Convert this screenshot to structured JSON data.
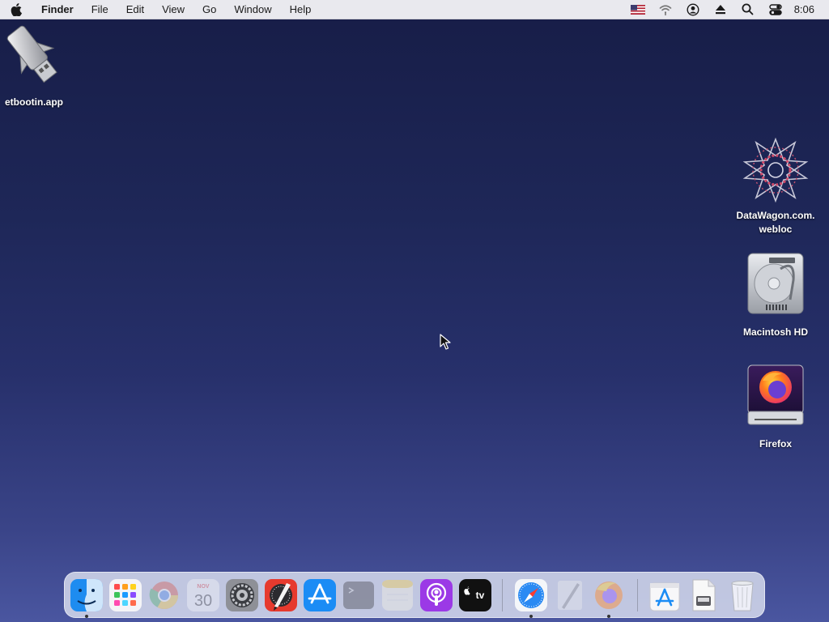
{
  "menubar": {
    "app_name": "Finder",
    "items": [
      "File",
      "Edit",
      "View",
      "Go",
      "Window",
      "Help"
    ],
    "status_icons": [
      "flag-us-icon",
      "wifi-icon",
      "user-icon",
      "eject-icon",
      "search-icon",
      "control-center-icon"
    ],
    "clock": "8:06"
  },
  "desktop": {
    "icons": [
      {
        "label": "etbootin.app",
        "icon": "usb-drive-icon"
      },
      {
        "label": "DataWagon.com.\nwebloc",
        "icon": "webloc-icon"
      },
      {
        "label": "Macintosh HD",
        "icon": "hard-drive-icon"
      },
      {
        "label": "Firefox",
        "icon": "firefox-disk-icon"
      }
    ]
  },
  "dock": {
    "apps": [
      {
        "name": "Finder",
        "icon": "finder-icon",
        "running": true
      },
      {
        "name": "Launchpad",
        "icon": "launchpad-icon",
        "running": false
      },
      {
        "name": "Chrome",
        "icon": "chrome-icon",
        "running": false
      },
      {
        "name": "Calendar",
        "icon": "calendar-icon",
        "running": false,
        "day": "30",
        "month": "NOV"
      },
      {
        "name": "System Preferences",
        "icon": "system-preferences-icon",
        "running": false
      },
      {
        "name": "Script Editor",
        "icon": "script-editor-icon",
        "running": false
      },
      {
        "name": "App Store",
        "icon": "app-store-icon",
        "running": false
      },
      {
        "name": "Terminal",
        "icon": "terminal-icon",
        "running": false
      },
      {
        "name": "Notes",
        "icon": "notes-icon",
        "running": false
      },
      {
        "name": "Podcasts",
        "icon": "podcasts-icon",
        "running": false
      },
      {
        "name": "TV",
        "icon": "apple-tv-icon",
        "running": false,
        "text": "tv"
      },
      {
        "name": "Safari",
        "icon": "safari-icon",
        "running": true
      },
      {
        "name": "TextEdit",
        "icon": "textedit-icon",
        "running": false
      },
      {
        "name": "Firefox",
        "icon": "firefox-icon",
        "running": true
      },
      {
        "name": "App Store Download",
        "icon": "app-store-download-icon",
        "running": false
      },
      {
        "name": "Document",
        "icon": "document-icon",
        "running": false
      },
      {
        "name": "Trash",
        "icon": "trash-icon",
        "running": false
      }
    ]
  },
  "colors": {
    "menubar_bg": "#e9e9ee",
    "desktop_top": "#171d47",
    "desktop_bottom": "#4a56a0"
  }
}
